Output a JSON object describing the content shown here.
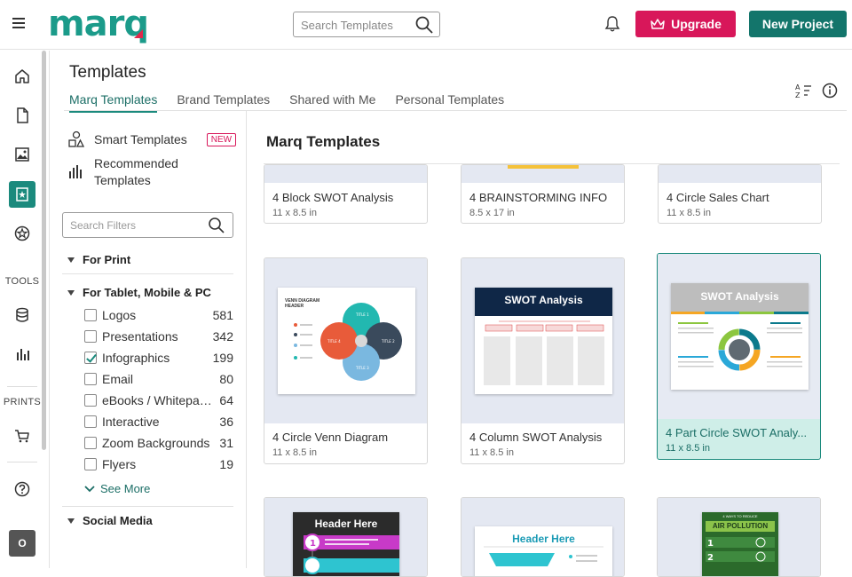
{
  "app": {
    "logo_text": "marq",
    "search_placeholder": "Search Templates",
    "upgrade_label": "Upgrade",
    "new_project_label": "New Project"
  },
  "rail": {
    "tools_label": "TOOLS",
    "prints_label": "PRINTS",
    "avatar_initial": "O"
  },
  "header": {
    "title": "Templates",
    "tabs": [
      {
        "label": "Marq Templates",
        "active": true
      },
      {
        "label": "Brand Templates",
        "active": false
      },
      {
        "label": "Shared with Me",
        "active": false
      },
      {
        "label": "Personal Templates",
        "active": false
      }
    ]
  },
  "filters": {
    "smart_templates": "Smart Templates",
    "new_badge": "NEW",
    "recommended": "Recommended Templates",
    "recommended_line1": "Recommended",
    "recommended_line2": "Templates",
    "search_placeholder": "Search Filters",
    "sections": [
      {
        "label": "For Print"
      },
      {
        "label": "For Tablet, Mobile & PC"
      },
      {
        "label": "Social Media"
      }
    ],
    "items": [
      {
        "label": "Logos",
        "count": "581",
        "checked": false
      },
      {
        "label": "Presentations",
        "count": "342",
        "checked": false
      },
      {
        "label": "Infographics",
        "count": "199",
        "checked": true
      },
      {
        "label": "Email",
        "count": "80",
        "checked": false
      },
      {
        "label": "eBooks / Whitepap...",
        "count": "64",
        "checked": false
      },
      {
        "label": "Interactive",
        "count": "36",
        "checked": false
      },
      {
        "label": "Zoom Backgrounds",
        "count": "31",
        "checked": false
      },
      {
        "label": "Flyers",
        "count": "19",
        "checked": false
      }
    ],
    "see_more": "See More"
  },
  "grid": {
    "title": "Marq Templates",
    "cards": [
      {
        "name": "4 Block SWOT Analysis",
        "size": "11 x 8.5 in"
      },
      {
        "name": "4 BRAINSTORMING INFO",
        "size": "8.5 x 17 in"
      },
      {
        "name": "4 Circle Sales Chart",
        "size": "11 x 8.5 in"
      },
      {
        "name": "4 Circle Venn Diagram",
        "size": "11 x 8.5 in"
      },
      {
        "name": "4 Column SWOT Analysis",
        "size": "11 x 8.5 in"
      },
      {
        "name": "4 Part Circle SWOT Analy...",
        "size": "11 x 8.5 in",
        "selected": true
      }
    ],
    "thumb_texts": {
      "venn_header": "VENN DIAGRAM HEADER",
      "venn_title": "TITLE",
      "swot_title": "SWOT Analysis",
      "header_here": "Header Here",
      "air_pollution": "AIR POLLUTION",
      "ways": "4 WAYS TO REDUCE"
    }
  },
  "colors": {
    "brand_teal": "#1b9b8a",
    "upgrade": "#d8175a",
    "new_project": "#13756b"
  }
}
